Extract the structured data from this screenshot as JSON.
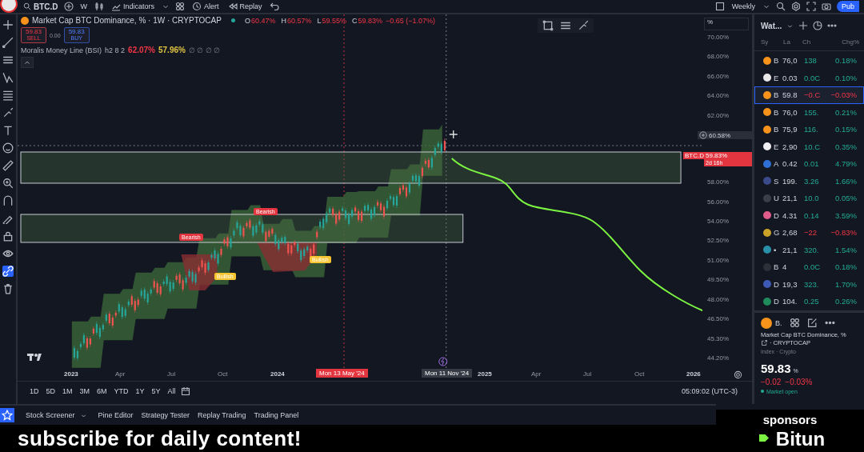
{
  "top_bar": {
    "symbol": "BTC.D",
    "interval": "W",
    "indicators": "Indicators",
    "alert": "Alert",
    "replay": "Replay",
    "layout": "Weekly",
    "publish": "Pub"
  },
  "legend": {
    "title": "Market Cap BTC Dominance, % · 1W · CRYPTOCAP",
    "ohlc": [
      {
        "key": "O",
        "value": "60.47%"
      },
      {
        "key": "H",
        "value": "60.57%"
      },
      {
        "key": "L",
        "value": "59.55%"
      },
      {
        "key": "C",
        "value": "59.83%"
      }
    ],
    "change": "−0.65 (−1.07%)",
    "sell": {
      "price": "59.83",
      "label": "SELL"
    },
    "spread": "0.00",
    "buy": {
      "price": "59.83",
      "label": "BUY"
    },
    "indicator": {
      "name": "Moralis Money Line (BSI)",
      "params": "h2 8 2",
      "values": [
        {
          "text": "62.07%",
          "color": "#f23645"
        },
        {
          "text": "57.96%",
          "color": "#e0c341"
        }
      ],
      "empty_values": "∅ ∅ ∅ ∅"
    }
  },
  "chart": {
    "signals": [
      {
        "label": "Bearish",
        "kind": "bearish"
      },
      {
        "label": "Bearish",
        "kind": "bearish"
      },
      {
        "label": "Bullish",
        "kind": "bullish"
      },
      {
        "label": "Bullish",
        "kind": "bullish"
      }
    ],
    "price_axis": {
      "unit": "%",
      "labels": [
        {
          "kind": "tick",
          "text": "70.00%"
        },
        {
          "kind": "tick",
          "text": "68.00%"
        },
        {
          "kind": "tick",
          "text": "66.00%"
        },
        {
          "kind": "tick",
          "text": "64.00%"
        },
        {
          "kind": "tick",
          "text": "62.00%"
        },
        {
          "kind": "crosshair",
          "text": "60.58%"
        },
        {
          "kind": "last",
          "symbol": "BTC.D",
          "text": "59.83%",
          "countdown": "2d 16h"
        },
        {
          "kind": "tick",
          "text": "58.00%"
        },
        {
          "kind": "tick",
          "text": "56.00%"
        },
        {
          "kind": "tick",
          "text": "54.00%"
        },
        {
          "kind": "tick",
          "text": "52.50%"
        },
        {
          "kind": "tick",
          "text": "51.00%"
        },
        {
          "kind": "tick",
          "text": "49.50%"
        },
        {
          "kind": "tick",
          "text": "48.00%"
        },
        {
          "kind": "tick",
          "text": "46.50%"
        },
        {
          "kind": "tick",
          "text": "45.30%"
        },
        {
          "kind": "tick",
          "text": "44.20%"
        }
      ]
    },
    "time_axis": {
      "labels": [
        "2023",
        "Apr",
        "Jul",
        "Oct",
        "2024",
        "2025",
        "Apr",
        "Jul",
        "Oct",
        "2026"
      ],
      "cursor_dates": [
        "Mon 13 May '24",
        "Mon 11 Nov '24"
      ]
    }
  },
  "ranges": [
    "1D",
    "5D",
    "1M",
    "3M",
    "6M",
    "YTD",
    "1Y",
    "5Y",
    "All"
  ],
  "clock": "05:09:02 (UTC-3)",
  "bottom_tabs": [
    "Stock Screener",
    "Pine Editor",
    "Strategy Tester",
    "Replay Trading",
    "Trading Panel"
  ],
  "watchlist": {
    "title": "Wat...",
    "columns": [
      "Sy",
      "La",
      "Ch",
      "Chg%"
    ],
    "rows": [
      {
        "symbol": "B",
        "last": "76,0",
        "change": "138",
        "change_pct": "0.18%",
        "negative": false,
        "selected": false,
        "color": "#f7931a"
      },
      {
        "symbol": "E",
        "last": "0.03",
        "change": "0.0C",
        "change_pct": "0.10%",
        "negative": false,
        "selected": false,
        "color": "#e8e8e8"
      },
      {
        "symbol": "B",
        "last": "59.8",
        "change": "−0.C",
        "change_pct": "−0.03%",
        "negative": true,
        "selected": true,
        "color": "#f7931a"
      },
      {
        "symbol": "B",
        "last": "76,0",
        "change": "155.",
        "change_pct": "0.21%",
        "negative": false,
        "selected": false,
        "color": "#f7931a"
      },
      {
        "symbol": "B",
        "last": "75,9",
        "change": "116.",
        "change_pct": "0.15%",
        "negative": false,
        "selected": false,
        "color": "#f7931a"
      },
      {
        "symbol": "E",
        "last": "2,90",
        "change": "10.C",
        "change_pct": "0.35%",
        "negative": false,
        "selected": false,
        "color": "#f0f0f5"
      },
      {
        "symbol": "A",
        "last": "0.42",
        "change": "0.01",
        "change_pct": "4.79%",
        "negative": false,
        "selected": false,
        "color": "#2f6fd6"
      },
      {
        "symbol": "S",
        "last": "199.",
        "change": "3.26",
        "change_pct": "1.66%",
        "negative": false,
        "selected": false,
        "color": "#3a4a8a"
      },
      {
        "symbol": "U",
        "last": "21,1",
        "change": "10.0",
        "change_pct": "0.05%",
        "negative": false,
        "selected": false,
        "color": "#3a3e48"
      },
      {
        "symbol": "D",
        "last": "4.31",
        "change": "0.14",
        "change_pct": "3.59%",
        "negative": false,
        "selected": false,
        "color": "#e05a8a"
      },
      {
        "symbol": "G",
        "last": "2,68",
        "change": "−22",
        "change_pct": "−0.83%",
        "negative": true,
        "selected": false,
        "color": "#c9a227"
      },
      {
        "symbol": "•",
        "last": "21,1",
        "change": "320.",
        "change_pct": "1.54%",
        "negative": false,
        "selected": false,
        "color": "#2a8fa8"
      },
      {
        "symbol": "B",
        "last": "4",
        "change": "0.0C",
        "change_pct": "0.18%",
        "negative": false,
        "selected": false,
        "color": "#2c3038"
      },
      {
        "symbol": "D",
        "last": "19,3",
        "change": "323.",
        "change_pct": "1.70%",
        "negative": false,
        "selected": false,
        "color": "#3d5bb5"
      },
      {
        "symbol": "D",
        "last": "104.",
        "change": "0.25",
        "change_pct": "0.26%",
        "negative": false,
        "selected": false,
        "color": "#1f8a5a"
      }
    ]
  },
  "details": {
    "symbol": "B.",
    "name": "Market Cap BTC Dominance, %",
    "exchange": "· CRYPTOCAP",
    "category": "Index · Crypto",
    "price": "59.83",
    "unit": "%",
    "change": "−0.02",
    "change_pct": "−0.03%",
    "status": "Market open"
  },
  "overlay": {
    "caption": "subscribe for daily content!",
    "sponsor_heading": "sponsors",
    "sponsor": "Bitun"
  }
}
